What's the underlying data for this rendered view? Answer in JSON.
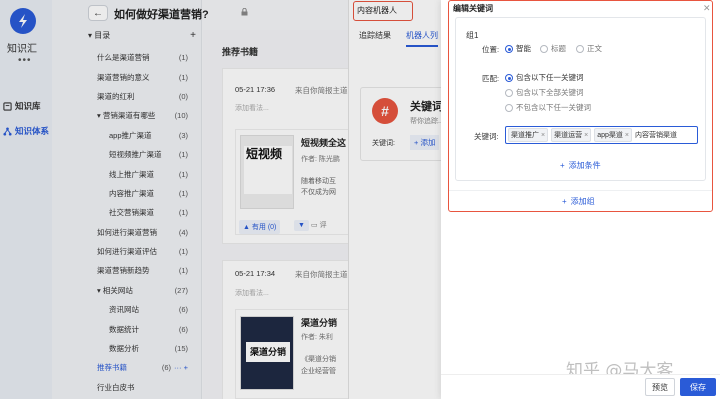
{
  "app": {
    "logo_text": "知识汇",
    "more": "•••"
  },
  "rail": {
    "items": [
      {
        "label": "知识库"
      },
      {
        "label": "知识体系"
      }
    ]
  },
  "doc": {
    "title": "如何做好渠道营销?"
  },
  "directory": {
    "header": "目录",
    "rows": [
      {
        "label": "什么是渠道营销",
        "count": "(1)",
        "level": 0
      },
      {
        "label": "渠道营销的意义",
        "count": "(1)",
        "level": 0
      },
      {
        "label": "渠道的红利",
        "count": "(0)",
        "level": 0
      },
      {
        "label": "营销渠道有哪些",
        "count": "(10)",
        "level": 0,
        "caret": "▾"
      },
      {
        "label": "app推广渠道",
        "count": "(3)",
        "level": 1
      },
      {
        "label": "短视频推广渠道",
        "count": "(1)",
        "level": 1
      },
      {
        "label": "线上推广渠道",
        "count": "(1)",
        "level": 1
      },
      {
        "label": "内容推广渠道",
        "count": "(1)",
        "level": 1
      },
      {
        "label": "社交营销渠道",
        "count": "(1)",
        "level": 1
      },
      {
        "label": "如何进行渠道营销",
        "count": "(4)",
        "level": 0
      },
      {
        "label": "如何进行渠道评估",
        "count": "(1)",
        "level": 0
      },
      {
        "label": "渠道营销新趋势",
        "count": "(1)",
        "level": 0
      },
      {
        "label": "相关网站",
        "count": "(27)",
        "level": 0,
        "caret": "▾"
      },
      {
        "label": "资讯网站",
        "count": "(6)",
        "level": 1
      },
      {
        "label": "数据统计",
        "count": "(6)",
        "level": 1
      },
      {
        "label": "数据分析",
        "count": "(15)",
        "level": 1
      },
      {
        "label": "推荐书籍",
        "count": "(6)",
        "level": 0,
        "selected": true
      },
      {
        "label": "行业白皮书",
        "count": "",
        "level": 0
      }
    ]
  },
  "middle": {
    "title": "推荐书籍",
    "cards": [
      {
        "date": "05-21 17:36",
        "source": "来自你简报主道",
        "add_note": "添加看法...",
        "book_title": "短视频全这",
        "author": "作者: 陈光鹏",
        "desc1": "随着移动互",
        "desc2": "不仅成为网",
        "cover_text": "短视频",
        "useful": "有用 (0)",
        "comment": "评"
      },
      {
        "date": "05-21 17:34",
        "source": "来自你简报主道",
        "add_note": "添加看法...",
        "book_title": "渠道分销",
        "author": "作者: 朱利",
        "desc1": "《渠道分销",
        "desc2": "企业经营管",
        "cover_text": "渠道分销"
      }
    ]
  },
  "drawer": {
    "title": "内容机器人",
    "tabs": [
      {
        "label": "追踪结果"
      },
      {
        "label": "机器人列"
      }
    ],
    "robot": {
      "icon_char": "#",
      "title": "关键词",
      "subtitle": "帮你追踪...",
      "keyword_label": "关键词:",
      "add": "+ 添加"
    }
  },
  "modal": {
    "title": "编辑关键词",
    "group_label": "组1",
    "position": {
      "label": "位置:",
      "options": [
        {
          "label": "智能",
          "checked": true
        },
        {
          "label": "标题",
          "checked": false
        },
        {
          "label": "正文",
          "checked": false
        }
      ]
    },
    "match": {
      "label": "匹配:",
      "options": [
        {
          "label": "包含以下任一关键词",
          "checked": true
        },
        {
          "label": "包含以下全部关键词",
          "checked": false
        },
        {
          "label": "不包含以下任一关键词",
          "checked": false
        }
      ]
    },
    "keywords": {
      "label": "关键词:",
      "tags": [
        {
          "label": "渠道推广"
        },
        {
          "label": "渠道运营"
        },
        {
          "label": "app渠道"
        }
      ],
      "typed": "内容营销渠道"
    },
    "add_condition": "添加条件",
    "add_group": "添加组",
    "preview": "预览",
    "save": "保存"
  },
  "watermark": "知乎 @马大客",
  "colors": {
    "accent": "#2a5bd7",
    "highlight": "#e8553f"
  }
}
